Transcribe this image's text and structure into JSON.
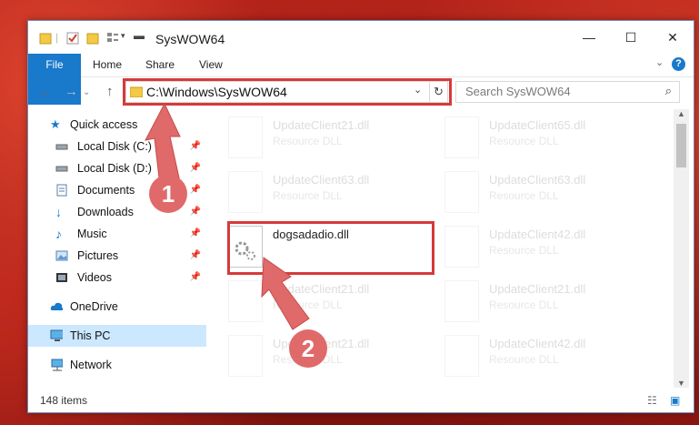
{
  "window": {
    "title": "SysWOW64"
  },
  "ribbon": {
    "tabs": [
      "File",
      "Home",
      "Share",
      "View"
    ]
  },
  "address": {
    "path": "C:\\Windows\\SysWOW64"
  },
  "search": {
    "placeholder": "Search SysWOW64"
  },
  "sidebar": {
    "items": [
      {
        "label": "Quick access",
        "icon": "star-icon"
      },
      {
        "label": "Local Disk (C:)",
        "icon": "drive-icon",
        "pinned": true
      },
      {
        "label": "Local Disk (D:)",
        "icon": "drive-icon",
        "pinned": true
      },
      {
        "label": "Documents",
        "icon": "documents-icon",
        "pinned": true
      },
      {
        "label": "Downloads",
        "icon": "download-icon",
        "pinned": true
      },
      {
        "label": "Music",
        "icon": "music-icon",
        "pinned": true
      },
      {
        "label": "Pictures",
        "icon": "pictures-icon",
        "pinned": true
      },
      {
        "label": "Videos",
        "icon": "videos-icon",
        "pinned": true
      },
      {
        "label": "OneDrive",
        "icon": "cloud-icon"
      },
      {
        "label": "This PC",
        "icon": "computer-icon",
        "selected": true
      },
      {
        "label": "Network",
        "icon": "network-icon"
      }
    ]
  },
  "files": {
    "col1": [
      {
        "name": "UpdateClient21.dll",
        "type": "Resource DLL"
      },
      {
        "name": "UpdateClient63.dll",
        "type": "Resource DLL"
      },
      {
        "name": "dogsadadio.dll",
        "type": ""
      },
      {
        "name": "UpdateClient21.dll",
        "type": "Resource DLL"
      },
      {
        "name": "UpdateClient21.dll",
        "type": "Resource DLL"
      }
    ],
    "col2": [
      {
        "name": "UpdateClient65.dll",
        "type": "Resource DLL"
      },
      {
        "name": "UpdateClient63.dll",
        "type": "Resource DLL"
      },
      {
        "name": "UpdateClient42.dll",
        "type": "Resource DLL"
      },
      {
        "name": "UpdateClient21.dll",
        "type": "Resource DLL"
      },
      {
        "name": "UpdateClient42.dll",
        "type": "Resource DLL"
      }
    ]
  },
  "status": {
    "count": "148 items"
  },
  "annotations": {
    "step1": "1",
    "step2": "2"
  },
  "colors": {
    "accent": "#1979ca",
    "highlight": "#d63a3a",
    "badge": "#e06a6a",
    "selected": "#cce8ff"
  }
}
